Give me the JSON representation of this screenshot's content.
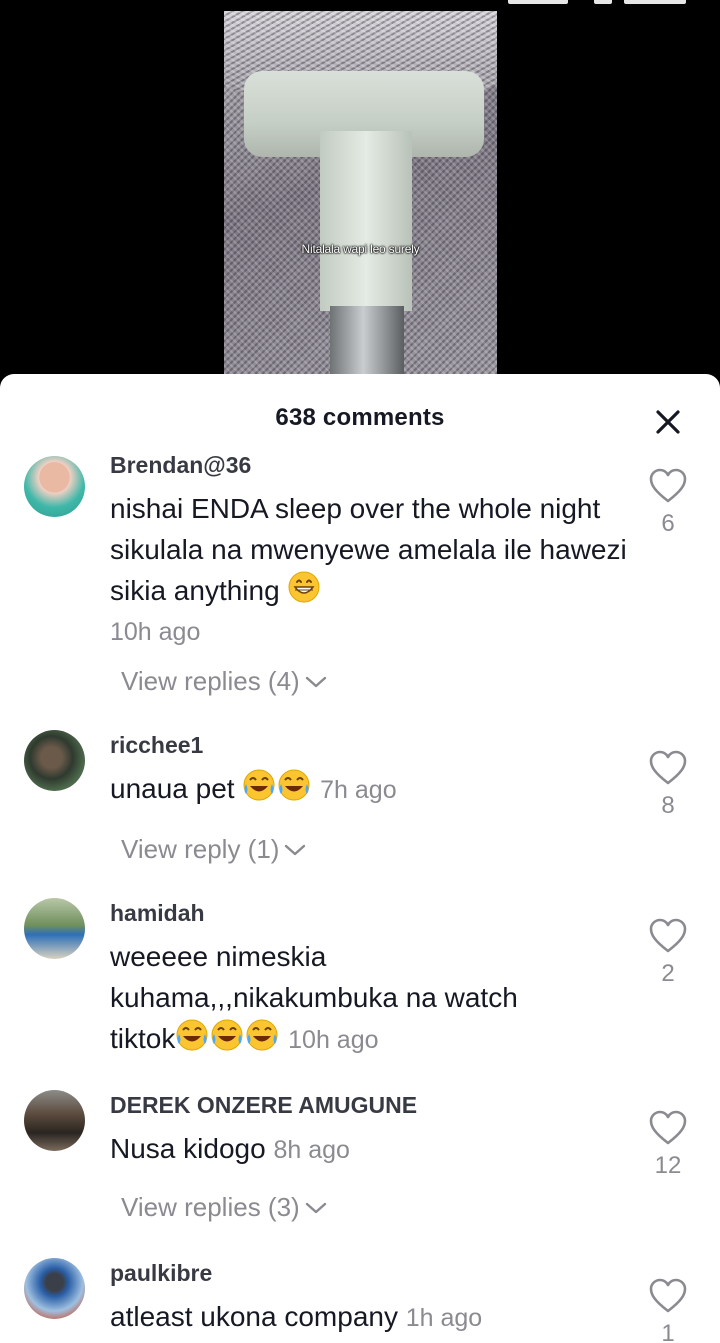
{
  "video": {
    "caption": "Nitalala wapi leo surely"
  },
  "sheet": {
    "title": "638 comments"
  },
  "comments": [
    {
      "username": "Brendan@36",
      "text": "nishai ENDA sleep over the whole night sikulala na mwenyewe amelala ile hawezi sikia anything",
      "emoji": "grinning",
      "time": "10h ago",
      "likes": "6",
      "replies": "View replies (4)"
    },
    {
      "username": "ricchee1",
      "text": "unaua pet",
      "emoji": "tears-of-joy x2",
      "time": "7h ago",
      "likes": "8",
      "replies": "View reply (1)"
    },
    {
      "username": "hamidah",
      "text_line1": "weeeee nimeskia",
      "text_line2": "kuhama,,,nikakumbuka na watch",
      "text_line3": "tiktok",
      "emoji": "tears-of-joy x3",
      "time": "10h ago",
      "likes": "2"
    },
    {
      "username": "DEREK ONZERE AMUGUNE",
      "text": "Nusa kidogo",
      "time": "8h ago",
      "likes": "12",
      "replies": "View replies (3)"
    },
    {
      "username": "paulkibre",
      "text": "atleast ukona company",
      "time": "1h ago",
      "likes": "1"
    }
  ],
  "colors": {
    "text": "#161823",
    "muted": "#8a8b91",
    "background": "#ffffff"
  }
}
